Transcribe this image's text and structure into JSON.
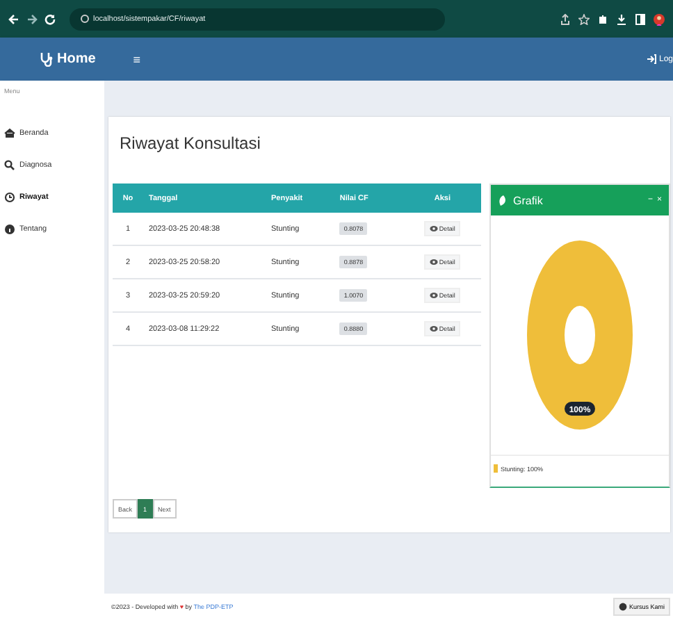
{
  "browser": {
    "url": "localhost/sistempakar/CF/riwayat"
  },
  "navbar": {
    "brand": "Home",
    "menu_toggle": "≡",
    "logout": "Log"
  },
  "sidebar": {
    "heading": "Menu",
    "items": [
      {
        "label": "Beranda",
        "selected": false
      },
      {
        "label": "Diagnosa",
        "selected": false
      },
      {
        "label": "Riwayat",
        "selected": true
      },
      {
        "label": "Tentang",
        "selected": false
      }
    ]
  },
  "page_title": "Riwayat Konsultasi",
  "table": {
    "columns": [
      "No",
      "Tanggal",
      "Penyakit",
      "Nilai CF",
      "Aksi"
    ],
    "rows": [
      {
        "no": "1",
        "tanggal": "2023-03-25 20:48:38",
        "penyakit": "Stunting",
        "nilai_cf": "0.8078",
        "aksi": "Detail"
      },
      {
        "no": "2",
        "tanggal": "2023-03-25 20:58:20",
        "penyakit": "Stunting",
        "nilai_cf": "0.8878",
        "aksi": "Detail"
      },
      {
        "no": "3",
        "tanggal": "2023-03-25 20:59:20",
        "penyakit": "Stunting",
        "nilai_cf": "1.0070",
        "aksi": "Detail"
      },
      {
        "no": "4",
        "tanggal": "2023-03-08 11:29:22",
        "penyakit": "Stunting",
        "nilai_cf": "0.8880",
        "aksi": "Detail"
      }
    ]
  },
  "pagination": [
    {
      "label": "Back",
      "selected": false
    },
    {
      "label": "1",
      "selected": true
    },
    {
      "label": "Next",
      "selected": false
    }
  ],
  "chart_card": {
    "title": "Grafik",
    "collapse": "−",
    "close": "×",
    "ring_label": "100%",
    "legend": [
      "Stunting: 100%"
    ]
  },
  "footer": {
    "text": "©2023 - Developed with ",
    "heart": "♥",
    "by": " by ",
    "link": "The PDP-ETP",
    "button": "Kursus Kami"
  }
}
